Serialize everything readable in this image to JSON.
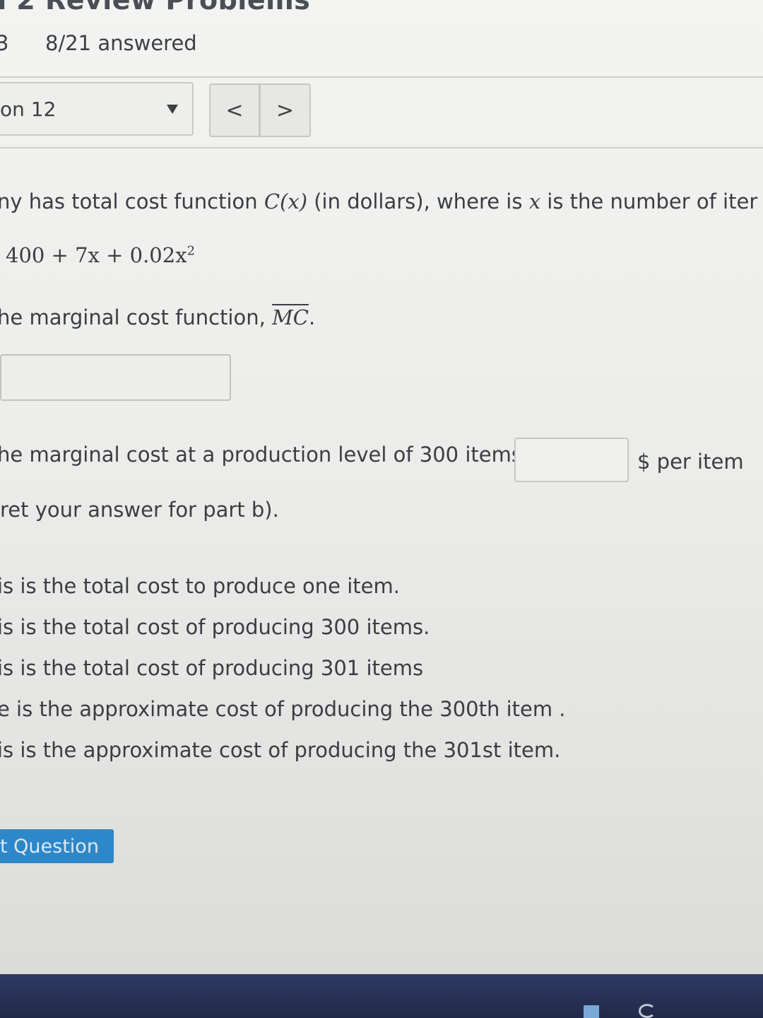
{
  "header": {
    "title": "n 2 Review Problems",
    "question_number": "3",
    "answered": "8/21 answered"
  },
  "nav": {
    "question_select": "on 12",
    "prev_label": "<",
    "next_label": ">"
  },
  "problem": {
    "intro_a": "ny has total cost function ",
    "intro_func": "C(x)",
    "intro_b": " (in dollars), where is ",
    "intro_var": "x",
    "intro_c": " is the number of iter",
    "equation": "400 + 7x + 0.02x",
    "equation_exp": "2",
    "part_a_prefix": "he marginal cost function, ",
    "part_a_symbol": "MC",
    "part_a_suffix": ".",
    "part_a_value": "",
    "part_b": "he marginal cost at a production level of 300 items.",
    "part_b_value": "",
    "part_b_unit": "$ per item",
    "part_c": "ret your answer for part b)."
  },
  "options": [
    "is is the total cost to produce one item.",
    "is is the total cost of producing 300 items.",
    "is is the total cost of producing 301 items",
    "e is the approximate cost of producing the 300th item .",
    "is is the approximate cost of producing the 301st item."
  ],
  "submit_label": "t Question"
}
